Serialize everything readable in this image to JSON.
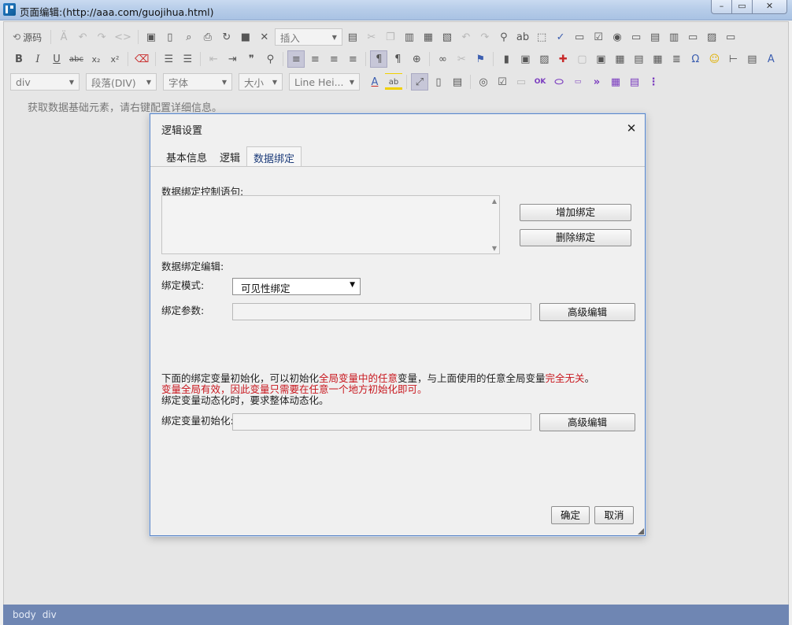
{
  "window": {
    "title": "页面编辑:(http://aaa.com/guojihua.html)",
    "min_glyph": "–",
    "max_glyph": "▭",
    "close_glyph": "✕"
  },
  "toolbar": {
    "source_label": "源码",
    "insert_select": "插入",
    "row2": {
      "bold": "B",
      "italic": "I",
      "underline": "U",
      "strike": "abc",
      "sub": "x₂",
      "sup": "x²",
      "omega": "Ω",
      "emoji": "☺"
    },
    "row3": {
      "block_select": "div",
      "format_select": "段落(DIV)",
      "font_select": "字体",
      "size_select": "大小",
      "lineheight_select": "Line Hei...",
      "font_color": "A",
      "bg_color": "ab"
    }
  },
  "editor": {
    "hint": "获取数据基础元素，请右键配置详细信息。"
  },
  "dialog": {
    "title": "逻辑设置",
    "close_glyph": "✕",
    "tabs": [
      {
        "label": "基本信息",
        "active": false
      },
      {
        "label": "逻辑",
        "active": false
      },
      {
        "label": "数据绑定",
        "active": true
      }
    ],
    "binding_statement_label": "数据绑定控制语句:",
    "add_binding_button": "增加绑定",
    "delete_binding_button": "删除绑定",
    "binding_edit_label": "数据绑定编辑:",
    "binding_mode_label": "绑定模式:",
    "binding_mode_value": "可见性绑定",
    "binding_params_label": "绑定参数:",
    "advanced_edit_button": "高级编辑",
    "notes": {
      "line1_a": "下面的绑定变量初始化，可以初始化",
      "line1_red1": "全局变量中的任意",
      "line1_b": "变量，与上面使用的任意全局变量",
      "line1_red2": "完全无关",
      "line1_c": "。",
      "line2_red": "变量全局有效，因此变量只需要在任意一个地方初始化即可。",
      "line3": "绑定变量动态化时，要求整体动态化。"
    },
    "var_init_label": "绑定变量初始化:",
    "advanced_edit_button2": "高级编辑",
    "ok_button": "确定",
    "cancel_button": "取消"
  },
  "statusbar": {
    "path": [
      "body",
      "div"
    ]
  },
  "colors": {
    "statusbar_bg": "#6f86b3",
    "dialog_border": "#5a86c8",
    "note_red": "#c8171e"
  }
}
